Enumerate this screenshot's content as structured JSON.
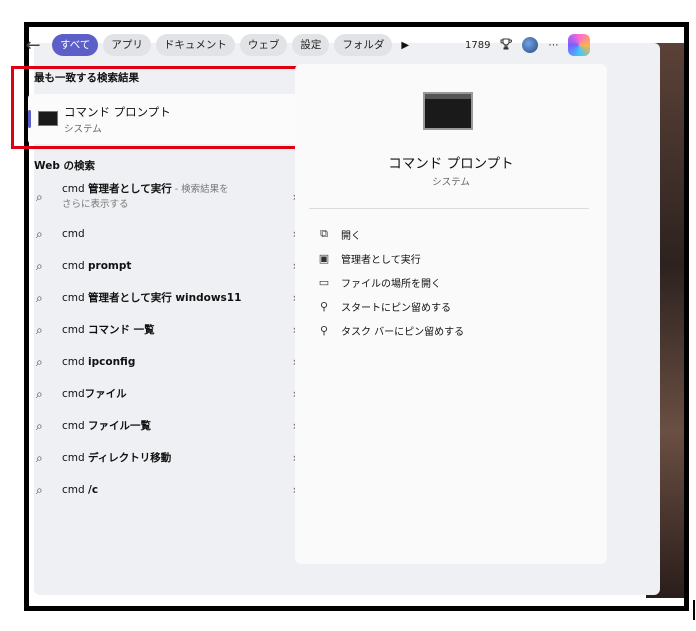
{
  "toolbar": {
    "back_icon": "←",
    "filters": [
      "すべて",
      "アプリ",
      "ドキュメント",
      "ウェブ",
      "設定",
      "フォルダ"
    ],
    "more_filters_icon": "▶",
    "points": "1789",
    "rewards_icon": "trophy-icon",
    "more_icon": "⋯"
  },
  "best_match": {
    "section_title": "最も一致する検索結果",
    "name": "コマンド プロンプト",
    "subtitle": "システム"
  },
  "web": {
    "section_title": "Web の検索",
    "results": [
      {
        "prefix": "cmd ",
        "bold": "管理者として実行",
        "hint": " - 検索結果を",
        "line2": "さらに表示する"
      },
      {
        "prefix": "cmd",
        "bold": "",
        "hint": "",
        "line2": ""
      },
      {
        "prefix": "cmd ",
        "bold": "prompt",
        "hint": "",
        "line2": ""
      },
      {
        "prefix": "cmd ",
        "bold": "管理者として実行 windows11",
        "hint": "",
        "line2": ""
      },
      {
        "prefix": "cmd ",
        "bold": "コマンド 一覧",
        "hint": "",
        "line2": ""
      },
      {
        "prefix": "cmd ",
        "bold": "ipconfig",
        "hint": "",
        "line2": ""
      },
      {
        "prefix": "cmd",
        "bold": "ファイル",
        "hint": "",
        "line2": ""
      },
      {
        "prefix": "cmd ",
        "bold": "ファイル一覧",
        "hint": "",
        "line2": ""
      },
      {
        "prefix": "cmd ",
        "bold": "ディレクトリ移動",
        "hint": "",
        "line2": ""
      },
      {
        "prefix": "cmd ",
        "bold": "/c",
        "hint": "",
        "line2": ""
      }
    ]
  },
  "detail": {
    "title": "コマンド プロンプト",
    "subtitle": "システム",
    "actions": [
      "開く",
      "管理者として実行",
      "ファイルの場所を開く",
      "スタートにピン留めする",
      "タスク バーにピン留めする"
    ]
  },
  "colors": {
    "accent": "#5b5fc7",
    "highlight_box": "#e00012"
  }
}
